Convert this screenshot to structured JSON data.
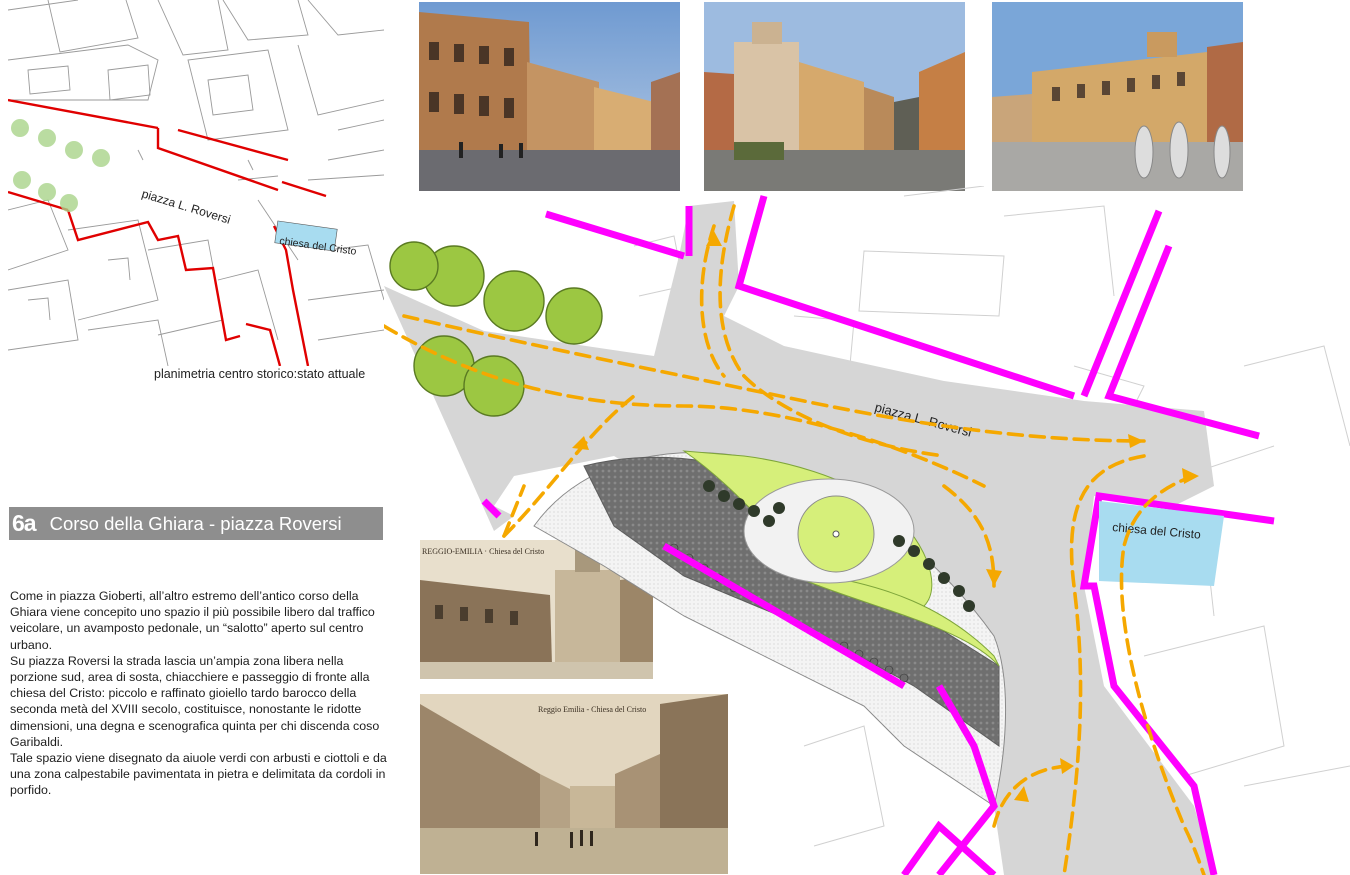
{
  "small_map": {
    "street_label": "piazza L. Roversi",
    "church_label": "chiesa del Cristo",
    "caption": "planimetria centro storico:stato attuale"
  },
  "title": {
    "number": "6a",
    "text": "Corso della Ghiara - piazza Roversi"
  },
  "description": [
    "Come in piazza Gioberti, all’altro estremo dell’antico corso della Ghiara viene concepito uno spazio il più possibile libero dal traffico veicolare, un avamposto pedonale, un “salotto” aperto sul centro urbano.",
    "Su piazza Roversi la strada lascia un’ampia zona libera nella porzione sud, area di sosta, chiacchiere e passeggio di fronte alla chiesa del Cristo: piccolo e raffinato gioiello tardo barocco della seconda metà del XVIII secolo, costituisce, nonostante le ridotte dimensioni, una degna e scenografica quinta per chi discenda coso Garibaldi.",
    "Tale spazio viene disegnato da aiuole verdi con arbusti e ciottoli e da una zona calpestabile pavimentata in pietra e delimitata da cordoli in porfido."
  ],
  "postcards": {
    "first_caption": "REGGIO-EMILIA · Chiesa del Cristo",
    "second_caption": "Reggio Emilia - Chiesa del Cristo"
  },
  "plan": {
    "square_label": "piazza L. Roversi",
    "church_label": "chiesa del Cristo"
  },
  "colors": {
    "building_outline": "#ff00ff",
    "road": "#d6d6d6",
    "flow_arrows": "#f5a800",
    "church": "#a8dcf0",
    "lawn": "#d6ef7a",
    "trees": "#9cc742",
    "paving": "#707070",
    "existing_facades": "#e00000"
  }
}
